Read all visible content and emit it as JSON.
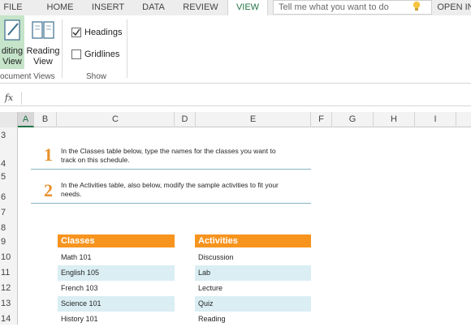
{
  "tabs": [
    "FILE",
    "HOME",
    "INSERT",
    "DATA",
    "REVIEW",
    "VIEW",
    "OPEN IN"
  ],
  "active_tab": "VIEW",
  "tell_me": "Tell me what you want to do",
  "ribbon": {
    "normal_label_1": "diting",
    "normal_label_2": "View",
    "reading_label_1": "Reading",
    "reading_label_2": "View",
    "document_views_label": "ocument Views",
    "headings_label": "Headings",
    "gridlines_label": "Gridlines",
    "show_label": "Show",
    "headings_checked": true,
    "gridlines_checked": false
  },
  "formula_bar": {
    "fx": "fx",
    "value": ""
  },
  "columns": [
    "A",
    "B",
    "C",
    "D",
    "E",
    "F",
    "G",
    "H",
    "I"
  ],
  "selected_column": "A",
  "rows": [
    "3",
    "4",
    "5",
    "6",
    "7",
    "8",
    "9",
    "10",
    "11",
    "12",
    "13",
    "14"
  ],
  "steps": [
    {
      "number": "1",
      "text_line1": "In the Classes table below, type the names for the classes you want to",
      "text_line2": "track on this schedule."
    },
    {
      "number": "2",
      "text_line1": "In the Activities table, also below, modify the sample activities to fit your",
      "text_line2": "needs."
    }
  ],
  "classes": {
    "header": "Classes",
    "items": [
      "Math 101",
      "English 105",
      "French 103",
      "Science 101",
      "History 101"
    ]
  },
  "activities": {
    "header": "Activities",
    "items": [
      "Discussion",
      "Lab",
      "Lecture",
      "Quiz",
      "Reading"
    ]
  },
  "colors": {
    "accent": "#217346",
    "table_header": "#f7941e",
    "band": "#daeef3",
    "step_number": "#e8902c"
  }
}
